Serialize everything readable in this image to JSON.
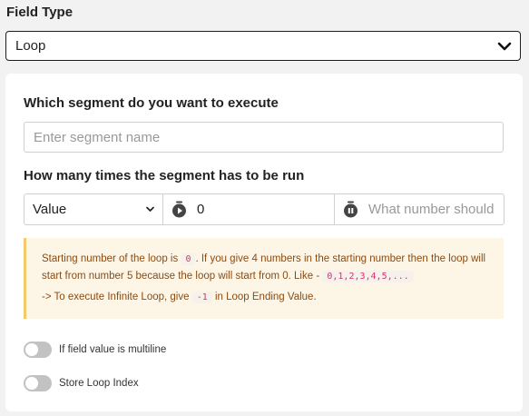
{
  "field_type": {
    "label": "Field Type",
    "selected": "Loop"
  },
  "loop": {
    "segment_question": "Which segment do you want to execute",
    "segment_placeholder": "Enter segment name",
    "runs_question": "How many times the segment has to be run",
    "mode_selected": "Value",
    "start_value": "0",
    "end_placeholder": "What number should"
  },
  "note": {
    "line1_a": "Starting number of the loop is",
    "code_zero": "0",
    "line1_b": ". If you give 4 numbers in the starting number then the loop will start from number 5 because the loop will start from 0. Like -",
    "code_seq": "0,1,2,3,4,5,...",
    "line2_a": "-> To execute Infinite Loop, give",
    "code_neg": "-1",
    "line2_b": "in Loop Ending Value."
  },
  "toggles": [
    {
      "label": "If field value is multiline",
      "on": false
    },
    {
      "label": "Store Loop Index",
      "on": false
    }
  ],
  "colors": {
    "note_bg": "#fdf6e7",
    "note_border": "#f5c96a",
    "note_text": "#8a4b12",
    "code_text": "#d6336c"
  },
  "icons": {
    "select_chevron": "chevron-down-icon",
    "mode_chevron": "chevron-down-icon",
    "start_icon": "timer-icon",
    "end_icon": "timer-pause-icon"
  }
}
